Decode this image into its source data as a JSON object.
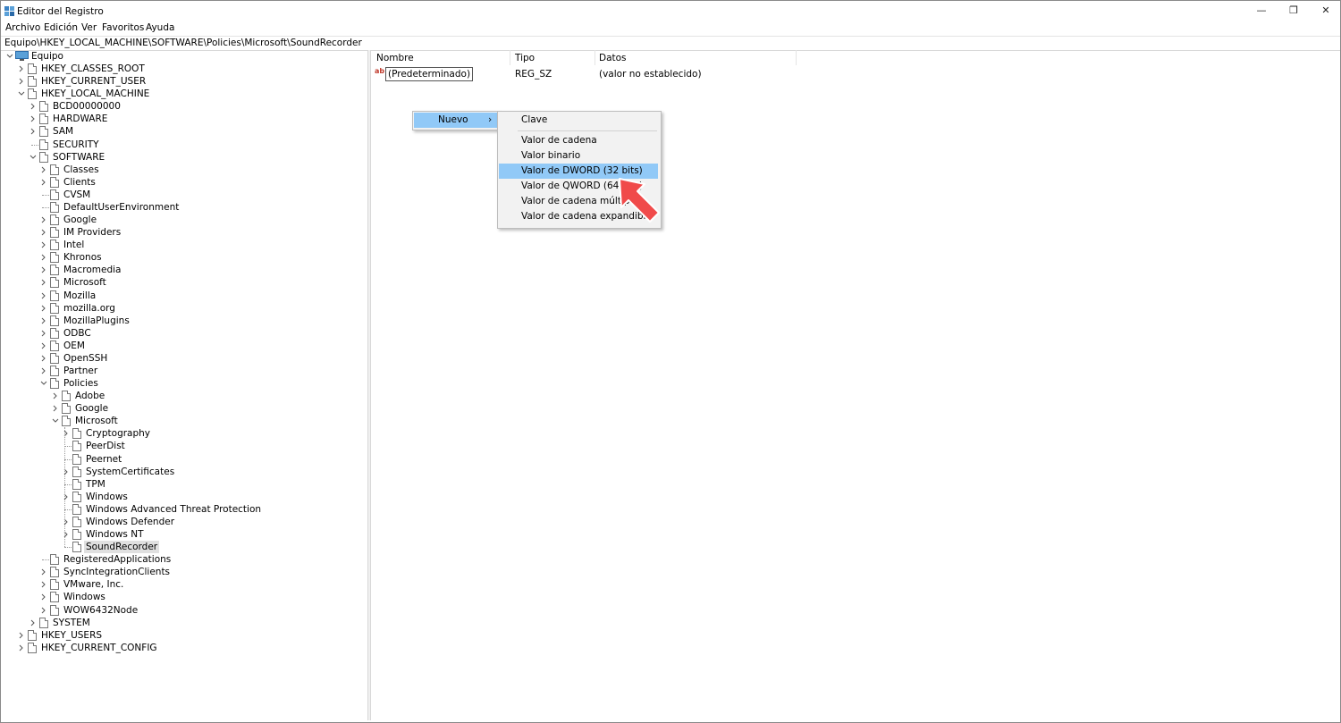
{
  "window": {
    "title": "Editor del Registro",
    "minimize_glyph": "—",
    "restore_glyph": "❐",
    "close_glyph": "✕",
    "app_icon": "registry-icon"
  },
  "menubar": [
    "Archivo",
    "Edición",
    "Ver",
    "Favoritos",
    "Ayuda"
  ],
  "address": "Equipo\\HKEY_LOCAL_MACHINE\\SOFTWARE\\Policies\\Microsoft\\SoundRecorder",
  "tree": {
    "root": "Equipo",
    "nodes": [
      {
        "label": "HKEY_CLASSES_ROOT",
        "depth": 1,
        "exp": "collapsed"
      },
      {
        "label": "HKEY_CURRENT_USER",
        "depth": 1,
        "exp": "collapsed"
      },
      {
        "label": "HKEY_LOCAL_MACHINE",
        "depth": 1,
        "exp": "expanded"
      },
      {
        "label": "BCD00000000",
        "depth": 2,
        "exp": "collapsed"
      },
      {
        "label": "HARDWARE",
        "depth": 2,
        "exp": "collapsed"
      },
      {
        "label": "SAM",
        "depth": 2,
        "exp": "collapsed"
      },
      {
        "label": "SECURITY",
        "depth": 2,
        "exp": "none"
      },
      {
        "label": "SOFTWARE",
        "depth": 2,
        "exp": "expanded"
      },
      {
        "label": "Classes",
        "depth": 3,
        "exp": "collapsed"
      },
      {
        "label": "Clients",
        "depth": 3,
        "exp": "collapsed"
      },
      {
        "label": "CVSM",
        "depth": 3,
        "exp": "none"
      },
      {
        "label": "DefaultUserEnvironment",
        "depth": 3,
        "exp": "none"
      },
      {
        "label": "Google",
        "depth": 3,
        "exp": "collapsed"
      },
      {
        "label": "IM Providers",
        "depth": 3,
        "exp": "collapsed"
      },
      {
        "label": "Intel",
        "depth": 3,
        "exp": "collapsed"
      },
      {
        "label": "Khronos",
        "depth": 3,
        "exp": "collapsed"
      },
      {
        "label": "Macromedia",
        "depth": 3,
        "exp": "collapsed"
      },
      {
        "label": "Microsoft",
        "depth": 3,
        "exp": "collapsed"
      },
      {
        "label": "Mozilla",
        "depth": 3,
        "exp": "collapsed"
      },
      {
        "label": "mozilla.org",
        "depth": 3,
        "exp": "collapsed"
      },
      {
        "label": "MozillaPlugins",
        "depth": 3,
        "exp": "collapsed"
      },
      {
        "label": "ODBC",
        "depth": 3,
        "exp": "collapsed"
      },
      {
        "label": "OEM",
        "depth": 3,
        "exp": "collapsed"
      },
      {
        "label": "OpenSSH",
        "depth": 3,
        "exp": "collapsed"
      },
      {
        "label": "Partner",
        "depth": 3,
        "exp": "collapsed"
      },
      {
        "label": "Policies",
        "depth": 3,
        "exp": "expanded"
      },
      {
        "label": "Adobe",
        "depth": 4,
        "exp": "collapsed"
      },
      {
        "label": "Google",
        "depth": 4,
        "exp": "collapsed"
      },
      {
        "label": "Microsoft",
        "depth": 4,
        "exp": "expanded"
      },
      {
        "label": "Cryptography",
        "depth": 5,
        "exp": "collapsed"
      },
      {
        "label": "PeerDist",
        "depth": 5,
        "exp": "none"
      },
      {
        "label": "Peernet",
        "depth": 5,
        "exp": "none"
      },
      {
        "label": "SystemCertificates",
        "depth": 5,
        "exp": "collapsed"
      },
      {
        "label": "TPM",
        "depth": 5,
        "exp": "none"
      },
      {
        "label": "Windows",
        "depth": 5,
        "exp": "collapsed"
      },
      {
        "label": "Windows Advanced Threat Protection",
        "depth": 5,
        "exp": "none"
      },
      {
        "label": "Windows Defender",
        "depth": 5,
        "exp": "collapsed"
      },
      {
        "label": "Windows NT",
        "depth": 5,
        "exp": "collapsed"
      },
      {
        "label": "SoundRecorder",
        "depth": 5,
        "exp": "none",
        "selected": true
      },
      {
        "label": "RegisteredApplications",
        "depth": 3,
        "exp": "none"
      },
      {
        "label": "SyncIntegrationClients",
        "depth": 3,
        "exp": "collapsed"
      },
      {
        "label": "VMware, Inc.",
        "depth": 3,
        "exp": "collapsed"
      },
      {
        "label": "Windows",
        "depth": 3,
        "exp": "collapsed"
      },
      {
        "label": "WOW6432Node",
        "depth": 3,
        "exp": "collapsed"
      },
      {
        "label": "SYSTEM",
        "depth": 2,
        "exp": "collapsed"
      },
      {
        "label": "HKEY_USERS",
        "depth": 1,
        "exp": "collapsed"
      },
      {
        "label": "HKEY_CURRENT_CONFIG",
        "depth": 1,
        "exp": "collapsed"
      }
    ]
  },
  "list": {
    "columns": [
      "Nombre",
      "Tipo",
      "Datos"
    ],
    "rows": [
      {
        "name": "(Predeterminado)",
        "type": "REG_SZ",
        "data": "(valor no establecido)",
        "icon": "string-value-icon",
        "icon_text": "ab"
      }
    ]
  },
  "context_menu": {
    "parent_label": "Nuevo",
    "parent_arrow": "›",
    "submenu": [
      "Clave",
      "Valor de cadena",
      "Valor binario",
      "Valor de DWORD (32 bits)",
      "Valor de QWORD (64 bits)",
      "Valor de cadena múltiple",
      "Valor de cadena expandible"
    ],
    "highlighted": "Valor de DWORD (32 bits)"
  },
  "colors": {
    "menu_highlight": "#91c9f7",
    "pointer_arrow": "#f04a4a"
  }
}
